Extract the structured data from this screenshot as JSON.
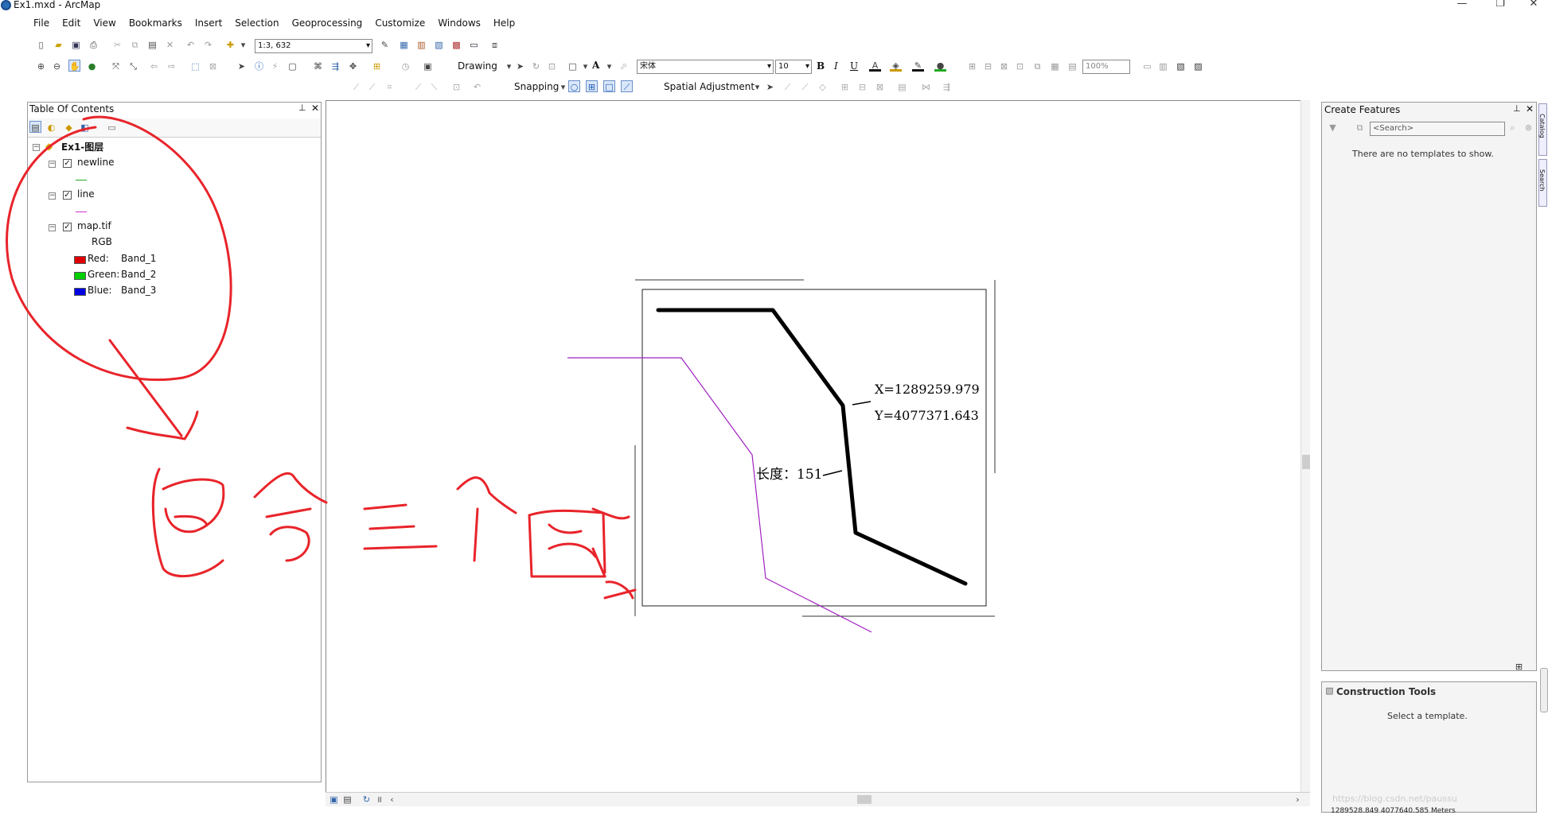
{
  "window": {
    "title": "Ex1.mxd - ArcMap",
    "controls": [
      "—",
      "❐",
      "✕"
    ]
  },
  "menu": [
    "File",
    "Edit",
    "View",
    "Bookmarks",
    "Insert",
    "Selection",
    "Geoprocessing",
    "Customize",
    "Windows",
    "Help"
  ],
  "toolbar": {
    "scale": "1:3, 632",
    "drawing_label": "Drawing",
    "font_name": "宋体",
    "font_size": "10",
    "bold": "B",
    "italic": "I",
    "underline": "U",
    "text_tool": "A",
    "snapping_label": "Snapping",
    "spatial_adjustment_label": "Spatial Adjustment",
    "zoom_level": "100%"
  },
  "toc": {
    "title": "Table Of Contents",
    "dataframe": "Ex1-图层",
    "layers": [
      {
        "name": "newline",
        "checked": true,
        "symbol_color": "#22aa22"
      },
      {
        "name": "line",
        "checked": true,
        "symbol_color": "#cc33cc"
      },
      {
        "name": "map.tif",
        "checked": true,
        "symbol_color": ""
      }
    ],
    "rgb_label": "RGB",
    "bands": [
      {
        "channel": "Red:",
        "band": "Band_1",
        "color": "#e00000"
      },
      {
        "channel": "Green:",
        "band": "Band_2",
        "color": "#00d000"
      },
      {
        "channel": "Blue:",
        "band": "Band_3",
        "color": "#0000e0"
      }
    ]
  },
  "map": {
    "x_label": "X=1289259.979",
    "y_label": "Y=4077371.643",
    "length_label": "长度：151",
    "annotation_text": "包含三个图层"
  },
  "create_features": {
    "title": "Create Features",
    "search_placeholder": "<Search>",
    "empty_message": "There are no templates to show."
  },
  "construction_tools": {
    "title": "Construction Tools",
    "message": "Select a template."
  },
  "side_tabs": [
    "Catalog",
    "Search"
  ],
  "status": {
    "coordinates": "1289528.849  4077640.585 Meters",
    "watermark": "https://blog.csdn.net/paussu"
  },
  "colors": {
    "annotation_red": "#e8242a",
    "newline_black": "#000000",
    "line_magenta": "#a020c0"
  }
}
